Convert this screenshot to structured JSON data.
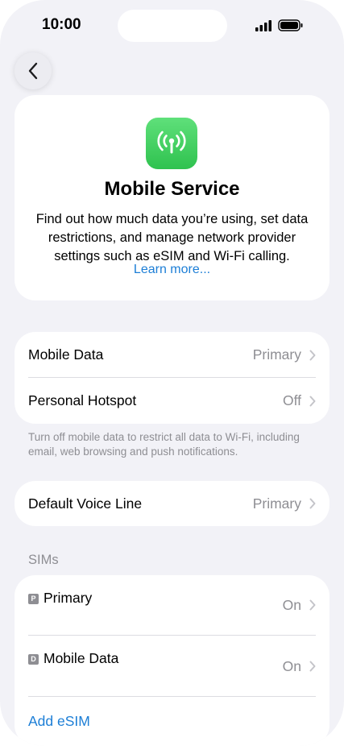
{
  "status": {
    "time": "10:00"
  },
  "hero": {
    "title": "Mobile Service",
    "description": "Find out how much data you’re using, set data restrictions, and manage network provider settings such as eSIM and Wi-Fi calling.",
    "link": "Learn more..."
  },
  "data_group": {
    "rows": [
      {
        "label": "Mobile Data",
        "value": "Primary"
      },
      {
        "label": "Personal Hotspot",
        "value": "Off"
      }
    ],
    "footnote": "Turn off mobile data to restrict all data to Wi-Fi, including email, web browsing and push notifications."
  },
  "voice_group": {
    "label": "Default Voice Line",
    "value": "Primary"
  },
  "sims": {
    "header": "SIMs",
    "items": [
      {
        "badge": "P",
        "label": "Primary",
        "value": "On"
      },
      {
        "badge": "D",
        "label": "Mobile Data",
        "value": "On"
      }
    ],
    "add_label": "Add eSIM"
  },
  "colors": {
    "accent": "#1c7ed6",
    "icon_green": "#34c759",
    "background": "#f2f2f7"
  }
}
